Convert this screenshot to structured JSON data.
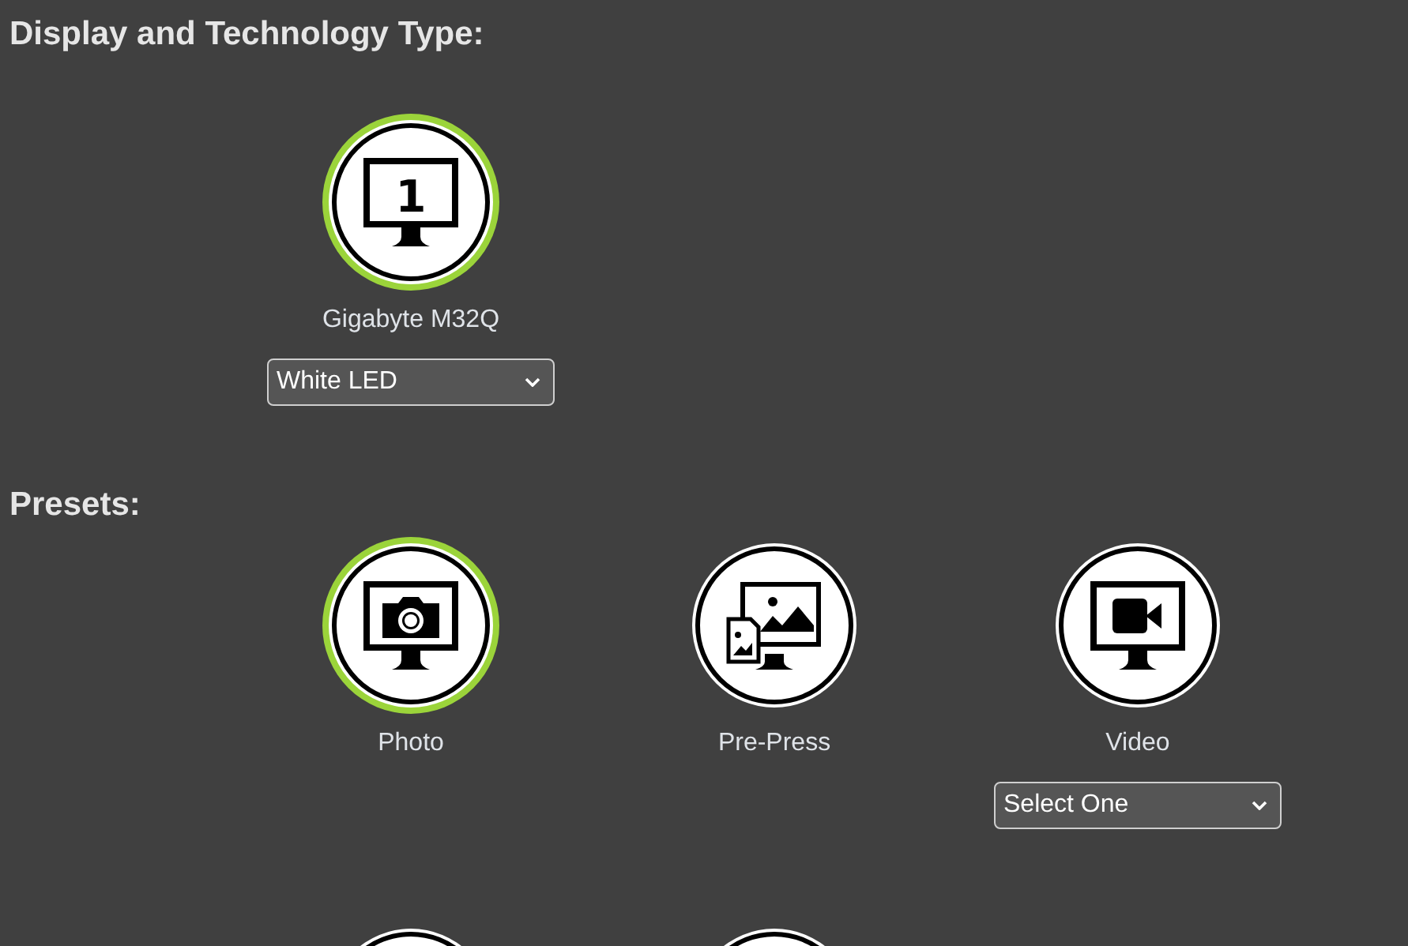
{
  "sections": [
    {
      "heading": "Display and Technology Type:",
      "items": [
        {
          "label": "Gigabyte M32Q",
          "selected": true,
          "kind": "number",
          "icon_text": "1",
          "dropdown": {
            "value": "White LED"
          }
        }
      ]
    },
    {
      "heading": "Presets:",
      "items": [
        {
          "label": "Photo",
          "selected": true,
          "kind": "camera"
        },
        {
          "label": "Pre-Press",
          "selected": false,
          "kind": "image"
        },
        {
          "label": "Video",
          "selected": false,
          "kind": "video",
          "dropdown": {
            "value": "Select One"
          }
        },
        {
          "selected": false,
          "kind": "partial"
        },
        {
          "selected": false,
          "kind": "partial"
        }
      ]
    }
  ]
}
